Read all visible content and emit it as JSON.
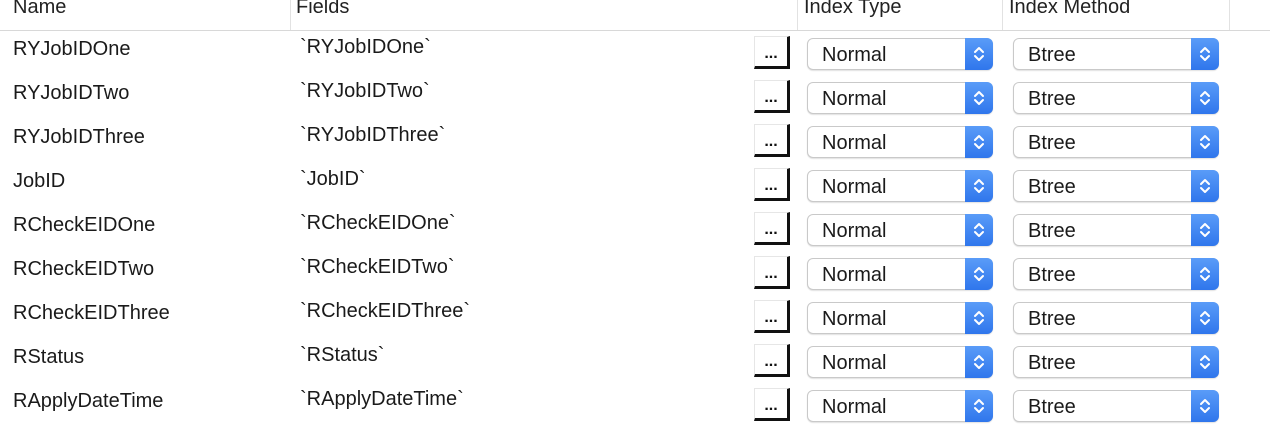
{
  "header": {
    "name": "Name",
    "fields": "Fields",
    "index_type": "Index Type",
    "index_method": "Index Method"
  },
  "rows": [
    {
      "name": "RYJobIDOne",
      "fields": "`RYJobIDOne`",
      "button": "...",
      "index_type": "Normal",
      "index_method": "Btree"
    },
    {
      "name": "RYJobIDTwo",
      "fields": "`RYJobIDTwo`",
      "button": "...",
      "index_type": "Normal",
      "index_method": "Btree"
    },
    {
      "name": "RYJobIDThree",
      "fields": "`RYJobIDThree`",
      "button": "...",
      "index_type": "Normal",
      "index_method": "Btree"
    },
    {
      "name": "JobID",
      "fields": "`JobID`",
      "button": "...",
      "index_type": "Normal",
      "index_method": "Btree"
    },
    {
      "name": "RCheckEIDOne",
      "fields": "`RCheckEIDOne`",
      "button": "...",
      "index_type": "Normal",
      "index_method": "Btree"
    },
    {
      "name": "RCheckEIDTwo",
      "fields": "`RCheckEIDTwo`",
      "button": "...",
      "index_type": "Normal",
      "index_method": "Btree"
    },
    {
      "name": "RCheckEIDThree",
      "fields": "`RCheckEIDThree`",
      "button": "...",
      "index_type": "Normal",
      "index_method": "Btree"
    },
    {
      "name": "RStatus",
      "fields": "`RStatus`",
      "button": "...",
      "index_type": "Normal",
      "index_method": "Btree"
    },
    {
      "name": "RApplyDateTime",
      "fields": "`RApplyDateTime`",
      "button": "...",
      "index_type": "Normal",
      "index_method": "Btree"
    }
  ],
  "icons": {
    "select_stepper": "chevron-up-down-icon"
  },
  "colors": {
    "stepper_accent": "#3b82f6"
  }
}
